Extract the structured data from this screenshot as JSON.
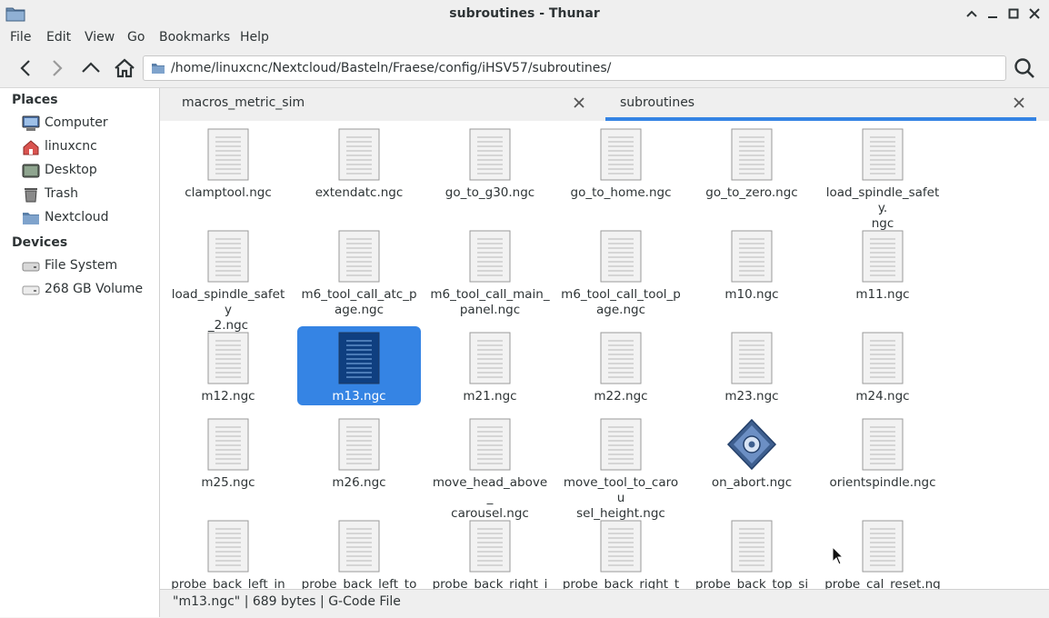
{
  "window": {
    "title": "subroutines - Thunar",
    "folder_icon": "folder-icon"
  },
  "menubar": [
    {
      "label": "File"
    },
    {
      "label": "Edit"
    },
    {
      "label": "View"
    },
    {
      "label": "Go"
    },
    {
      "label": "Bookmarks"
    },
    {
      "label": "Help"
    }
  ],
  "location": {
    "path": "/home/linuxcnc/Nextcloud/Basteln/Fraese/config/iHSV57/subroutines/"
  },
  "sidebar": {
    "places_header": "Places",
    "places": [
      {
        "label": "Computer",
        "icon": "computer-icon"
      },
      {
        "label": "linuxcnc",
        "icon": "home-icon"
      },
      {
        "label": "Desktop",
        "icon": "desktop-icon"
      },
      {
        "label": "Trash",
        "icon": "trash-icon"
      },
      {
        "label": "Nextcloud",
        "icon": "folder-icon"
      }
    ],
    "devices_header": "Devices",
    "devices": [
      {
        "label": "File System",
        "icon": "drive-icon"
      },
      {
        "label": "268 GB Volume",
        "icon": "drive-icon"
      }
    ]
  },
  "tabs": [
    {
      "label": "macros_metric_sim",
      "active": false
    },
    {
      "label": "subroutines",
      "active": true
    }
  ],
  "files": [
    {
      "name": "clamptool.ngc"
    },
    {
      "name": "extendatc.ngc"
    },
    {
      "name": "go_to_g30.ngc"
    },
    {
      "name": "go_to_home.ngc"
    },
    {
      "name": "go_to_zero.ngc"
    },
    {
      "name": "load_spindle_safety.\nngc"
    },
    {
      "name": "load_spindle_safety\n_2.ngc"
    },
    {
      "name": "m6_tool_call_atc_p\nage.ngc"
    },
    {
      "name": "m6_tool_call_main_\npanel.ngc"
    },
    {
      "name": "m6_tool_call_tool_p\nage.ngc"
    },
    {
      "name": "m10.ngc"
    },
    {
      "name": "m11.ngc"
    },
    {
      "name": "m12.ngc"
    },
    {
      "name": "m13.ngc",
      "selected": true
    },
    {
      "name": "m21.ngc"
    },
    {
      "name": "m22.ngc"
    },
    {
      "name": "m23.ngc"
    },
    {
      "name": "m24.ngc"
    },
    {
      "name": "m25.ngc"
    },
    {
      "name": "m26.ngc"
    },
    {
      "name": "move_head_above_\ncarousel.ngc"
    },
    {
      "name": "move_tool_to_carou\nsel_height.ngc"
    },
    {
      "name": "on_abort.ngc",
      "icon": "executable-icon"
    },
    {
      "name": "orientspindle.ngc"
    },
    {
      "name": "probe_back_left_ins"
    },
    {
      "name": "probe_back_left_top"
    },
    {
      "name": "probe_back_right_in"
    },
    {
      "name": "probe_back_right_to"
    },
    {
      "name": "probe_back_top_sid"
    },
    {
      "name": "probe_cal_reset.ngc"
    }
  ],
  "statusbar": {
    "text": "\"m13.ngc\"  |  689 bytes  |  G-Code File"
  },
  "colors": {
    "accent": "#3584e4",
    "background": "#f6f5f4"
  }
}
